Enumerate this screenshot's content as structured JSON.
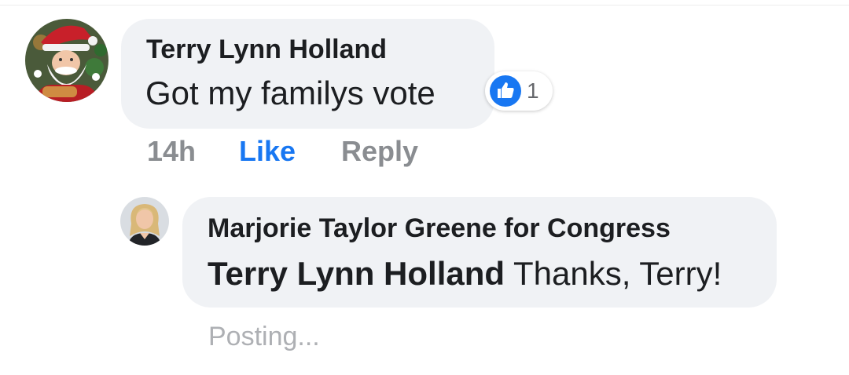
{
  "colors": {
    "bubble": "#f0f2f5",
    "text": "#1c1e21",
    "link_blue": "#1877f2",
    "meta_gray": "#8a8d91",
    "posting_gray": "#aeb0b4"
  },
  "comment": {
    "author": "Terry Lynn Holland",
    "text": "Got my familys vote",
    "avatar_icon": "santa-claus-avatar",
    "reaction": {
      "icon": "thumbs-up-icon",
      "count": "1"
    },
    "meta": {
      "time": "14h",
      "like_label": "Like",
      "reply_label": "Reply"
    }
  },
  "reply": {
    "author": "Marjorie Taylor Greene for Congress",
    "mention": "Terry Lynn Holland",
    "text": "Thanks, Terry!",
    "avatar_icon": "profile-photo-avatar",
    "status": "Posting..."
  }
}
